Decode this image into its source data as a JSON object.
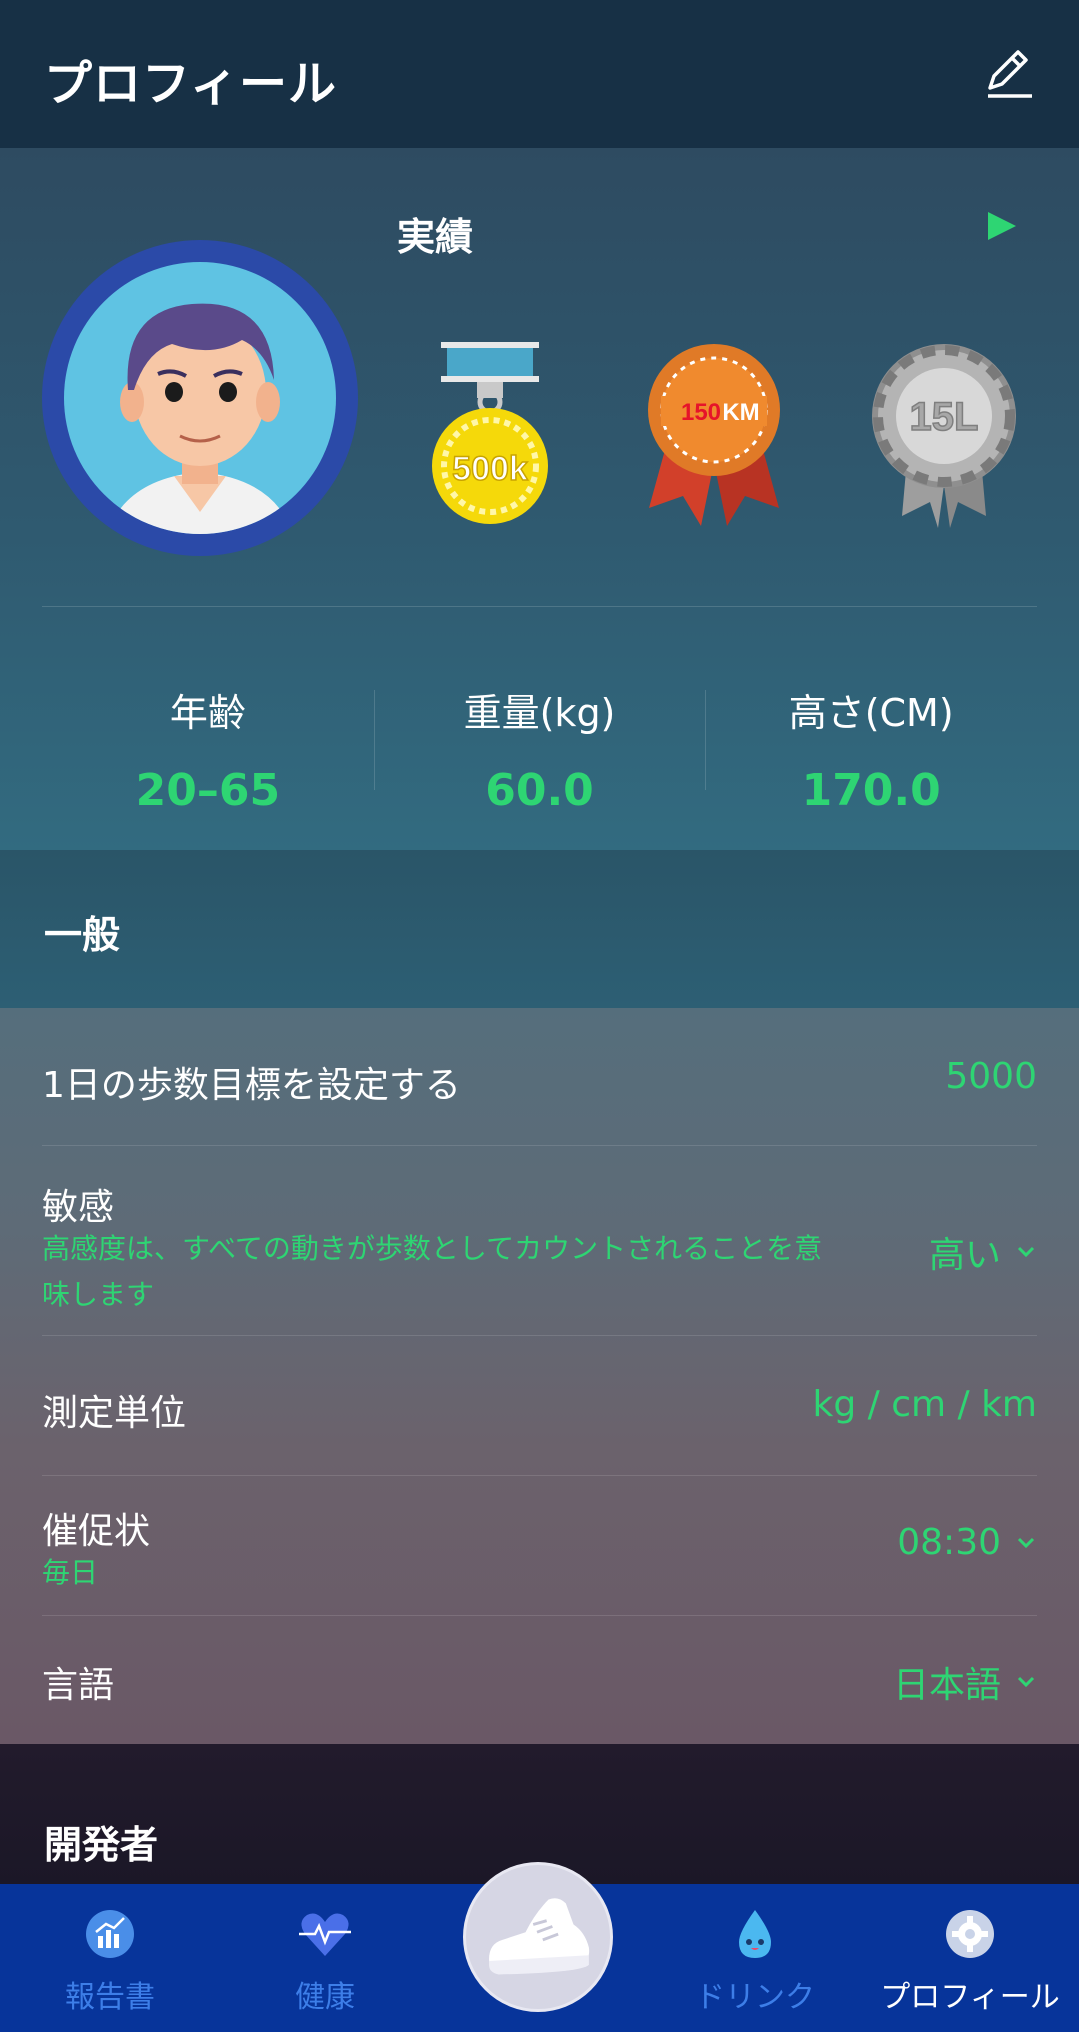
{
  "header": {
    "title": "プロフィール",
    "edit_icon": "pencil-icon"
  },
  "achievements": {
    "label": "実績",
    "play_icon": "play-icon",
    "medals": [
      {
        "icon": "medal-500k-icon",
        "text": "500k",
        "color": "#f5d90a"
      },
      {
        "icon": "medal-150km-icon",
        "text": "150KM",
        "color": "#e07a27"
      },
      {
        "icon": "medal-15l-icon",
        "text": "15L",
        "color": "#a8a8a8"
      }
    ]
  },
  "stats": [
    {
      "label": "年齢",
      "value": "20–65"
    },
    {
      "label": "重量(kg)",
      "value": "60.0"
    },
    {
      "label": "高さ(CM)",
      "value": "170.0"
    }
  ],
  "general": {
    "title": "一般",
    "step_goal": {
      "label": "1日の歩数目標を設定する",
      "value": "5000"
    },
    "sensitivity": {
      "label": "敏感",
      "description_line1": "高感度は、すべての動きが歩数としてカウントされることを意",
      "description_line2": "味します",
      "value": "高い"
    },
    "units": {
      "label": "測定単位",
      "value": "kg / cm / km"
    },
    "reminder": {
      "label": "催促状",
      "sub": "毎日",
      "value": "08:30"
    },
    "language": {
      "label": "言語",
      "value": "日本語"
    }
  },
  "developer": {
    "title": "開発者"
  },
  "nav": {
    "items": [
      {
        "label": "報告書",
        "icon": "report-chart-icon"
      },
      {
        "label": "健康",
        "icon": "heart-pulse-icon"
      },
      {
        "label": "",
        "icon": "sneaker-icon"
      },
      {
        "label": "ドリンク",
        "icon": "water-drop-icon"
      },
      {
        "label": "プロフィール",
        "icon": "gear-icon",
        "active": true
      }
    ]
  },
  "colors": {
    "accent": "#2ed573",
    "nav_bg": "#07349a",
    "nav_inactive": "#3d7ee8"
  }
}
